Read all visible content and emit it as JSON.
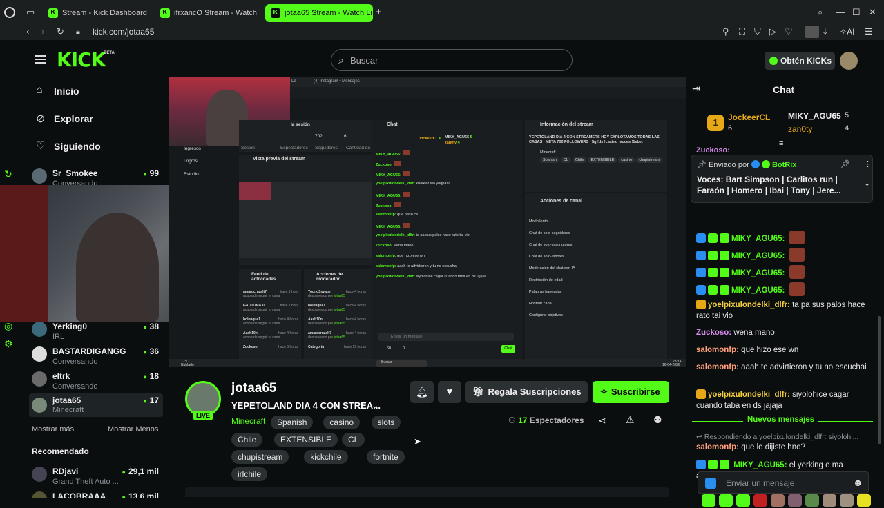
{
  "browser": {
    "tabs": [
      {
        "label": "Stream - Kick Dashboard"
      },
      {
        "label": "ifrxancO Stream - Watch L"
      },
      {
        "label": "jotaa65 Stream - Watch Li"
      }
    ],
    "url": "kick.com/jotaa65",
    "ai_label": "AI"
  },
  "header": {
    "logo": "KICK",
    "beta": "BETA",
    "search_placeholder": "Buscar",
    "kicks_button": "Obtén KICKs"
  },
  "sidebar": {
    "nav": [
      "Inicio",
      "Explorar",
      "Siguiendo"
    ],
    "following": [
      {
        "name": "Sr_Smokee",
        "status": "Conversando",
        "viewers": "99"
      },
      {
        "name": "Yerking0",
        "status": "IRL",
        "viewers": "38"
      },
      {
        "name": "BASTARDIGANGG",
        "status": "Conversando",
        "viewers": "36"
      },
      {
        "name": "eltrk",
        "status": "Conversando",
        "viewers": "18"
      },
      {
        "name": "jotaa65",
        "status": "Minecraft",
        "viewers": "17"
      }
    ],
    "show_more": "Mostrar más",
    "show_less": "Mostrar Menos",
    "recommended_title": "Recomendado",
    "recommended": [
      {
        "name": "RDjavi",
        "status": "Grand Theft Auto ...",
        "viewers": "29,1 mil"
      },
      {
        "name": "LACOBRAAA",
        "status": "",
        "viewers": "13,6 mil"
      }
    ]
  },
  "stream": {
    "inner": {
      "tabs": [
        "Le",
        "(4) Instagram • Mensajes"
      ],
      "nav_items": [
        "Ingresos",
        "Logros",
        "Estudio"
      ],
      "session_title": "la sesión",
      "session_stats": [
        {
          "value": "702",
          "label": "Espectadores"
        },
        {
          "value": "6",
          "label": "Seguidores"
        },
        {
          "label": "Cantidad de"
        }
      ],
      "session_label": "Sesión",
      "preview_title": "Vista previa del stream",
      "chat_title": "Chat",
      "info_title": "Información del stream",
      "info_text": "YEPETOLAND DIA 4 CON STREAMERS HOY EXPLOTAMOS TODAS LAS CASAS | META 700 FOLLOWERS | !ig !ds !casino !voces !1xbet",
      "info_category": "Minecraft",
      "info_tags": [
        "Spanish",
        "CL",
        "Chile",
        "EXTENSIBLE",
        "casino",
        "chupistream"
      ],
      "mini_leader": [
        {
          "name": "JockeerCL",
          "count": "6"
        },
        {
          "name": "MIKY_AGU65",
          "count": "5"
        },
        {
          "name": "zan0ty",
          "count": "4"
        }
      ],
      "mini_chat": [
        {
          "user": "MIKY_AGU65:",
          "text": ""
        },
        {
          "user": "Zuckoso:",
          "text": ""
        },
        {
          "user": "MIKY_AGU65:",
          "text": ""
        },
        {
          "user": "yoelpixulondelki_dlfr:",
          "text": "kualkier wa yoqpasa"
        },
        {
          "user": "MIKY_AGU65:",
          "text": ""
        },
        {
          "user": "Zuckoso:",
          "text": ""
        },
        {
          "user": "salomonfp:",
          "text": "que paso ce"
        },
        {
          "user": "MIKY_AGU65:",
          "text": ""
        },
        {
          "user": "yoelpixulondelki_dlfr:",
          "text": "ta pa sus palos hace rato tai vio"
        },
        {
          "user": "Zuckoso:",
          "text": "wena mano"
        },
        {
          "user": "salomonfp:",
          "text": "que hizo ese wn"
        },
        {
          "user": "salomonfp:",
          "text": "aaah te advirtieron y tu no escuchai"
        },
        {
          "user": "yoelpixulondelki_dlfr:",
          "text": "siyolohice cagar cuando taba en ds jajaja"
        }
      ],
      "mini_input": "Enviar un mensaje",
      "mini_chat_button": "Chat",
      "mini_counts": [
        "60",
        "0"
      ],
      "actions_title": "Acciones de canal",
      "actions": [
        "Modo lento",
        "Chat de solo-seguidores",
        "Chat de solo-suscriptores",
        "Chat de solo-emotes",
        "Moderación del chat con IA",
        "Restricción de edad",
        "Palabras baneadas",
        "Hostear canal",
        "Configurar objetivos"
      ],
      "feed_title": "Feed de actividades",
      "feed": [
        {
          "name": "amarocruzalt7",
          "text": "acaba de seguir el canal",
          "time": "hace 1 hora"
        },
        {
          "name": "GATITOMAXI",
          "text": "acaba de seguir el canal",
          "time": "hace 1 hora"
        },
        {
          "name": "bolenque1",
          "text": "acaba de seguir el canal",
          "time": "hace 4 horas"
        },
        {
          "name": "Aash10n",
          "text": "acaba de seguir el canal",
          "time": "hace 4 horas"
        },
        {
          "name": "Zuckoso",
          "text": "",
          "time": "hace 5 horas"
        }
      ],
      "mod_title": "Acciones de moderador",
      "mod": [
        {
          "name": "YoungSxvage",
          "text": "desbaneado por",
          "by": "jotaa65",
          "time": "hace 4 horas"
        },
        {
          "name": "bolenque1",
          "text": "desbaneado por",
          "by": "jotaa65",
          "time": "hace 4 horas"
        },
        {
          "name": "Aash10n",
          "text": "desbaneado por",
          "by": "jotaa65",
          "time": "hace 4 horas"
        },
        {
          "name": "amarocruzalt7",
          "text": "desbaneado por",
          "by": "jotaa65",
          "time": "hace 4 horas"
        },
        {
          "name": "Categoría",
          "text": "",
          "by": "",
          "time": "hace 19 horas"
        }
      ],
      "taskbar_search": "Buscar",
      "weather": "17°C",
      "weather_desc": "Nublado",
      "clock_time": "23:14",
      "clock_date": "16-04-2026"
    }
  },
  "channel": {
    "name": "jotaa65",
    "title": "YEPETOLAND DIA 4 CON STREA...",
    "live_badge": "LIVE",
    "category": "Minecraft",
    "tags_row1": [
      "Spanish",
      "casino",
      "slots"
    ],
    "tags_row2": [
      "Chile",
      "EXTENSIBLE",
      "CL"
    ],
    "tags_row3": [
      "chupistream",
      "kickchile",
      "fortnite"
    ],
    "tags_row4": [
      "irlchile"
    ],
    "gift_button": "Regala Suscripciones",
    "subscribe_button": "Suscribirse",
    "viewer_count": "17",
    "viewer_label": "Espectadores"
  },
  "chat": {
    "title": "Chat",
    "leaders": [
      {
        "rank": "1",
        "name": "JockeerCL",
        "count": "6"
      },
      {
        "rank": "",
        "name": "MIKY_AGU65",
        "count": "5"
      },
      {
        "rank": "",
        "name": "zan0ty",
        "count": "4"
      }
    ],
    "pinned_by_label": "Enviado por",
    "pinned_by": "BotRix",
    "pinned_text": "Voces: Bart Simpson | Carlitos run | Faraón | Homero | Ibai | Tony | Jere...",
    "partial_user": "Zuckoso:",
    "messages": [
      {
        "user": "MIKY_AGU65:",
        "text": "",
        "color": "#53fc18"
      },
      {
        "user": "MIKY_AGU65:",
        "text": "",
        "color": "#53fc18"
      },
      {
        "user": "MIKY_AGU65:",
        "text": "",
        "color": "#53fc18"
      },
      {
        "user": "MIKY_AGU65:",
        "text": "",
        "color": "#53fc18"
      },
      {
        "user": "yoelpixulondelki_dlfr:",
        "text": "ta pa sus palos hace rato tai vio",
        "color": "#f4d03f"
      },
      {
        "user": "Zuckoso:",
        "text": "wena mano",
        "color": "#d98cf0"
      },
      {
        "user": "salomonfp:",
        "text": "que hizo ese wn",
        "color": "#ff9f7a"
      },
      {
        "user": "salomonfp:",
        "text": "aaah te advirtieron y tu no escuchai",
        "color": "#ff9f7a"
      },
      {
        "user": "yoelpixulondelki_dlfr:",
        "text": "siyolohice cagar cuando taba en ds jajaja",
        "color": "#f4d03f"
      }
    ],
    "new_messages": "Nuevos mensajes",
    "reply_to": "Respondiendo a yoelpixulondelki_dlfr: siyolohi...",
    "reply_user": "salomonfp:",
    "reply_text": "que le dijiste hno?",
    "last_user": "MIKY_AGU65:",
    "last_text": "el yerking e ma aweonao k la paloma",
    "input_placeholder": "Enviar un mensaje"
  },
  "colors": {
    "accent": "#53fc18",
    "bg": "#0b0e0f"
  }
}
